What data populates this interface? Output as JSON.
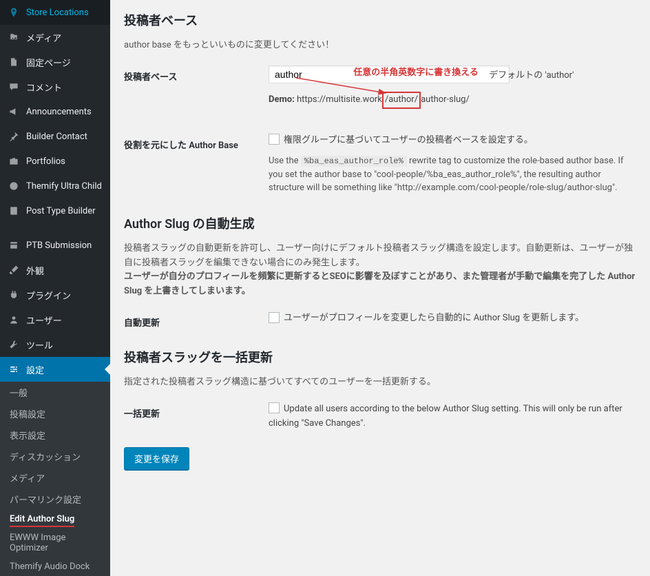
{
  "sidebar": {
    "items": [
      {
        "label": "Store Locations",
        "icon": "pin"
      },
      {
        "label": "メディア",
        "icon": "media"
      },
      {
        "label": "固定ページ",
        "icon": "page"
      },
      {
        "label": "コメント",
        "icon": "comment"
      },
      {
        "label": "Announcements",
        "icon": "megaphone"
      },
      {
        "label": "Builder Contact",
        "icon": "pin2"
      },
      {
        "label": "Portfolios",
        "icon": "portfolio"
      },
      {
        "label": "Themify Ultra Child",
        "icon": "theme"
      },
      {
        "label": "Post Type Builder",
        "icon": "ptb"
      },
      {
        "label": "PTB Submission",
        "icon": "submit"
      },
      {
        "label": "外観",
        "icon": "brush"
      },
      {
        "label": "プラグイン",
        "icon": "plugin"
      },
      {
        "label": "ユーザー",
        "icon": "users"
      },
      {
        "label": "ツール",
        "icon": "tools"
      },
      {
        "label": "設定",
        "icon": "settings",
        "current": true
      }
    ],
    "submenu": [
      {
        "label": "一般"
      },
      {
        "label": "投稿設定"
      },
      {
        "label": "表示設定"
      },
      {
        "label": "ディスカッション"
      },
      {
        "label": "メディア"
      },
      {
        "label": "パーマリンク設定"
      },
      {
        "label": "Edit Author Slug",
        "active": true
      },
      {
        "label": "EWWW Image Optimizer"
      },
      {
        "label": "Themify Audio Dock"
      }
    ]
  },
  "sections": {
    "authorBase": {
      "heading": "投稿者ベース",
      "desc": "author base をもっといいものに変更してください！",
      "fieldLabel": "投稿者ベース",
      "input": "author",
      "annotation": "任意の半角英数字に書き換える",
      "defaultNote": "デフォルトの 'author'",
      "demoLabel": "Demo:",
      "demoPrefix": "https://multisite.work",
      "demoBox": "/author/",
      "demoSuffix": "author-slug/",
      "roleLabel": "役割を元にした Author Base",
      "roleCheckboxText": "権限グループに基づいてユーザーの投稿者ベースを設定する。",
      "roleHelp1": "Use the ",
      "roleCode": "%ba_eas_author_role%",
      "roleHelp2": " rewrite tag to customize the role-based author base. If you set the author base to \"cool-people/%ba_eas_author_role%\", the resulting author structure will be something like \"http://example.com/cool-people/role-slug/author-slug\"."
    },
    "autoGen": {
      "heading": "Author Slug の自動生成",
      "desc1": "投稿者スラッグの自動更新を許可し、ユーザー向けにデフォルト投稿者スラッグ構造を設定します。自動更新は、ユーザーが独自に投稿者スラッグを編集できない場合にのみ発生します。",
      "desc2": "ユーザーが自分のプロフィールを頻繁に更新するとSEOに影響を及ぼすことがあり、また管理者が手動で編集を完了した Author Slug を上書きしてしまいます。",
      "fieldLabel": "自動更新",
      "checkboxText": "ユーザーがプロフィールを変更したら自動的に Author Slug を更新します。"
    },
    "bulk": {
      "heading": "投稿者スラッグを一括更新",
      "desc": "指定された投稿者スラッグ構造に基づいてすべてのユーザーを一括更新する。",
      "fieldLabel": "一括更新",
      "checkboxText": "Update all users according to the below Author Slug setting. This will only be run after clicking \"Save Changes\"."
    },
    "saveBtn": "変更を保存"
  }
}
